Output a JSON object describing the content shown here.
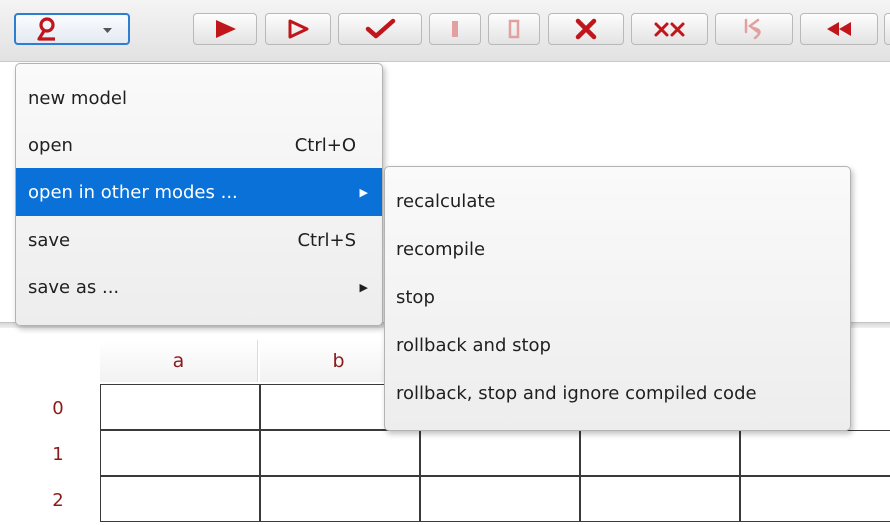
{
  "toolbar": {
    "model_menu_button": {
      "icon": "model-icon",
      "dropdown": "chevron-down-icon"
    },
    "buttons": [
      {
        "name": "run-button",
        "icon": "play-filled-icon",
        "color": "#c0161b"
      },
      {
        "name": "step-button",
        "icon": "play-outline-icon",
        "color": "#c0161b"
      },
      {
        "name": "check-button",
        "icon": "checkmark-icon",
        "color": "#c0161b"
      },
      {
        "name": "pause-button",
        "icon": "bar-icon",
        "color": "#e3a0a0"
      },
      {
        "name": "stop-button",
        "icon": "stop-outline-icon",
        "color": "#e3a0a0"
      },
      {
        "name": "cancel-button",
        "icon": "x-icon",
        "color": "#c0161b"
      },
      {
        "name": "cancel-all-button",
        "icon": "double-x-icon",
        "color": "#c0161b"
      },
      {
        "name": "return-button",
        "icon": "return-icon",
        "color": "#e3a0a0"
      },
      {
        "name": "rewind-button",
        "icon": "rewind-icon",
        "color": "#c0161b"
      }
    ]
  },
  "file_menu": {
    "items": [
      {
        "label": "new model",
        "shortcut": "",
        "submenu": false,
        "selected": false
      },
      {
        "label": "open",
        "shortcut": "Ctrl+O",
        "submenu": false,
        "selected": false
      },
      {
        "label": "open in other modes ...",
        "shortcut": "",
        "submenu": true,
        "selected": true
      },
      {
        "label": "save",
        "shortcut": "Ctrl+S",
        "submenu": false,
        "selected": false
      },
      {
        "label": "save as ...",
        "shortcut": "",
        "submenu": true,
        "selected": false
      }
    ]
  },
  "submenu": {
    "items": [
      {
        "label": "recalculate"
      },
      {
        "label": "recompile"
      },
      {
        "label": "stop"
      },
      {
        "label": "rollback and stop"
      },
      {
        "label": "rollback, stop and ignore compiled code"
      }
    ]
  },
  "grid": {
    "columns": [
      "a",
      "b"
    ],
    "rows": [
      "0",
      "1",
      "2"
    ]
  },
  "colors": {
    "accent": "#0a71d8",
    "icon_red": "#c0161b",
    "header_text": "#8b1a1a"
  }
}
